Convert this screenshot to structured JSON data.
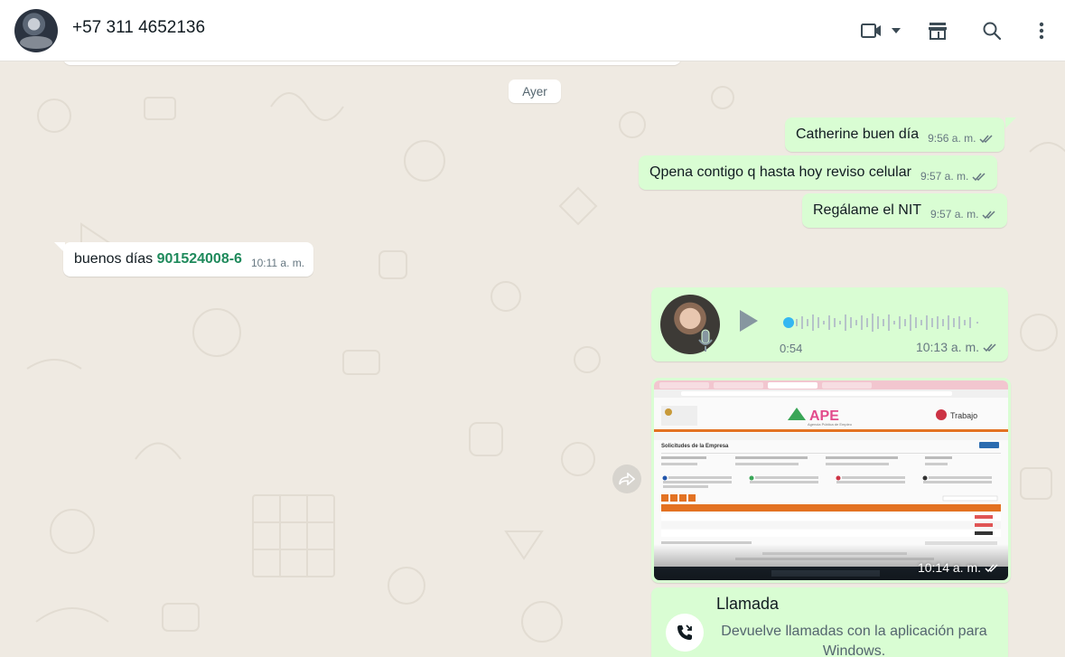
{
  "header": {
    "contact_name": "+57 311 4652136"
  },
  "chat": {
    "date_separator": "Ayer",
    "messages": [
      {
        "direction": "out",
        "text": "Catherine buen día",
        "time": "9:56 a. m."
      },
      {
        "direction": "out",
        "text": "Qpena contigo q hasta hoy reviso celular",
        "time": "9:57 a. m."
      },
      {
        "direction": "out",
        "text": "Regálame el NIT",
        "time": "9:57 a. m."
      },
      {
        "direction": "in",
        "text": "buenos días ",
        "highlight": "901524008-6",
        "time": "10:11 a. m."
      }
    ],
    "voice": {
      "duration": "0:54",
      "time": "10:13 a. m."
    },
    "image": {
      "time": "10:14 a. m.",
      "page_title": "Solicitudes de la Empresa",
      "brand": "APE",
      "brand_sub": "Agencia Pública de Empleo",
      "right_brand": "Trabajo"
    },
    "call": {
      "title": "Llamada",
      "subtitle": "Devuelve llamadas con la aplicación para Windows."
    }
  },
  "colors": {
    "outgoing_bubble": "#d9fdd3",
    "incoming_bubble": "#ffffff",
    "chat_background": "#efeae2",
    "ticks_read": "#667781",
    "highlight_text": "#1f8a5c"
  },
  "icons": [
    "video-call-icon",
    "chevron-down-icon",
    "store-icon",
    "search-icon",
    "more-vertical-icon",
    "read-ticks-icon",
    "play-icon",
    "mic-icon",
    "forward-icon",
    "missed-call-icon"
  ]
}
